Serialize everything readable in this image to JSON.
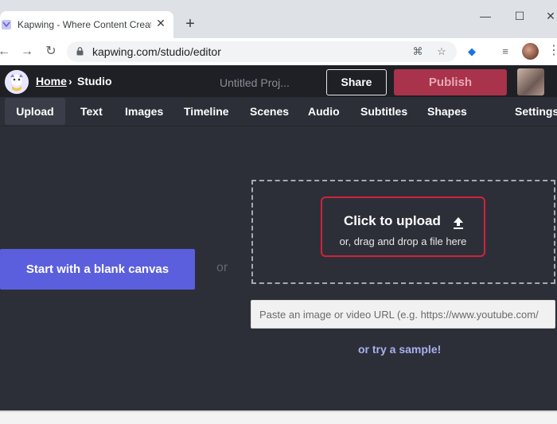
{
  "browser": {
    "tab_title": "Kapwing - Where Content Creatio",
    "tab_close": "✕",
    "new_tab": "+",
    "window_controls": {
      "minimize": "—",
      "maximize": "☐",
      "close": "✕"
    },
    "nav": {
      "back": "←",
      "forward": "→",
      "reload": "↻"
    },
    "url": "kapwing.com/studio/editor",
    "icons": [
      "translate-icon",
      "star-icon",
      "extension-icon",
      "reading-list-icon",
      "profile-avatar",
      "menu-icon"
    ]
  },
  "app": {
    "breadcrumb": {
      "home": "Home",
      "separator": "›",
      "current": "Studio"
    },
    "project_title": "Untitled Proj...",
    "share_label": "Share",
    "publish_label": "Publish",
    "tabs": [
      "Upload",
      "Text",
      "Images",
      "Timeline",
      "Scenes",
      "Audio",
      "Subtitles",
      "Shapes",
      "Settings"
    ],
    "active_tab": "Upload"
  },
  "main": {
    "blank_canvas_label": "Start with a blank canvas",
    "or_label": "or",
    "upload_title": "Click to upload",
    "upload_subtitle": "or, drag and drop a file here",
    "url_placeholder": "Paste an image or video URL (e.g. https://www.youtube.com/",
    "sample_link": "or try a sample!"
  },
  "colors": {
    "app_background": "#2d2f38",
    "header_background": "#1f2026",
    "publish": "#a8334a",
    "primary_button": "#5b5fde",
    "highlight_border": "#d1223b",
    "sample_link": "#a7b1f0"
  }
}
